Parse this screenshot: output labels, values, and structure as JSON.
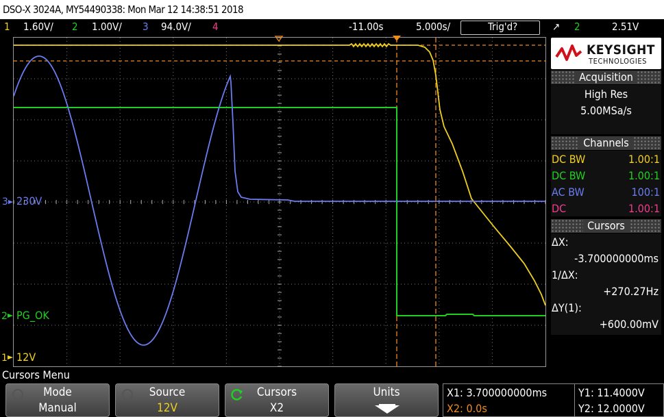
{
  "title": "DSO-X 3024A, MY54490338: Mon Mar 12 14:38:51 2018",
  "channels": [
    {
      "num": "1",
      "scale": "1.60V/",
      "color": "#f0d020"
    },
    {
      "num": "2",
      "scale": "1.00V/",
      "color": "#20d020"
    },
    {
      "num": "3",
      "scale": "94.0V/",
      "color": "#6a7cf0"
    },
    {
      "num": "4",
      "scale": "",
      "color": "#f03c8c"
    }
  ],
  "timebase": {
    "delay": "-11.00s",
    "scale": "5.000s/"
  },
  "trigger": {
    "status": "Trig'd?",
    "source": "2",
    "level": "2.51V"
  },
  "traces": {
    "ch3_label": "230V",
    "ch2_label": "PG_OK",
    "ch1_label": "12V"
  },
  "brand": {
    "name": "KEYSIGHT",
    "sub": "TECHNOLOGIES"
  },
  "acquisition": {
    "title": "Acquisition",
    "mode": "High Res",
    "rate": "5.00MSa/s"
  },
  "channels_panel": {
    "title": "Channels",
    "rows": [
      {
        "coupling": "DC BW",
        "probe": "1.00:1",
        "color": "#f0d020"
      },
      {
        "coupling": "DC BW",
        "probe": "1.00:1",
        "color": "#20d020"
      },
      {
        "coupling": "AC BW",
        "probe": "100:1",
        "color": "#6a7cf0"
      },
      {
        "coupling": "DC",
        "probe": "1.00:1",
        "color": "#f03c8c"
      }
    ]
  },
  "cursors_panel": {
    "title": "Cursors",
    "dx_label": "ΔX:",
    "dx_value": "-3.700000000ms",
    "inv_label": "1/ΔX:",
    "inv_value": "+270.27Hz",
    "dy_label": "ΔY(1):",
    "dy_value": "+600.00mV"
  },
  "menu": {
    "title": "Cursors Menu"
  },
  "softkeys": [
    {
      "top": "Mode",
      "bottom": "Manual"
    },
    {
      "top": "Source",
      "bottom": "12V"
    },
    {
      "top": "Cursors",
      "bottom": "X2"
    },
    {
      "top": "Units",
      "bottom": ""
    }
  ],
  "readout": {
    "x1": "X1: 3.700000000ms",
    "x2": "X2: 0.0s",
    "y1": "Y1: 11.4000V",
    "y2": "Y2: 12.0000V"
  }
}
